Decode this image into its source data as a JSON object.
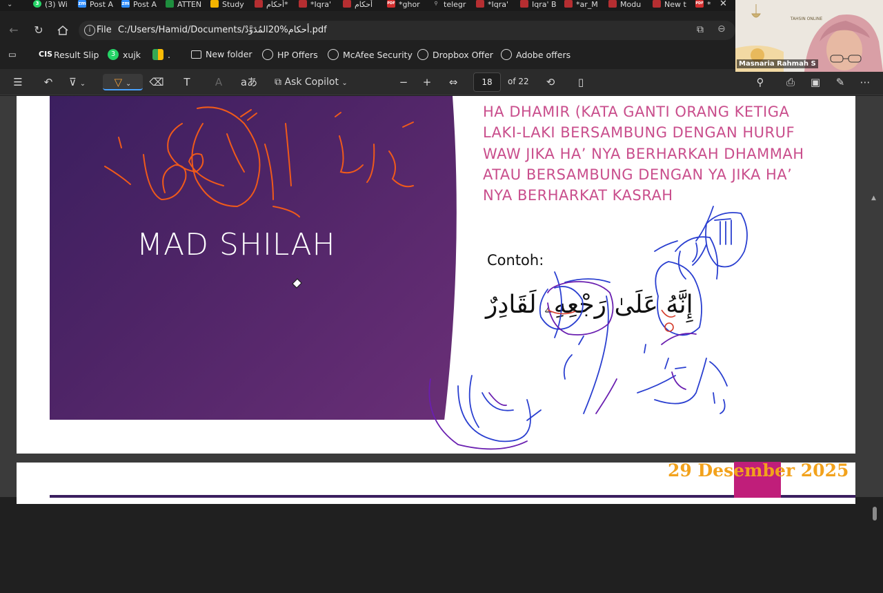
{
  "tabs": [
    {
      "label": "(3) Wi",
      "icon": "whatsapp-icon",
      "color": "#25d366",
      "badge": "3"
    },
    {
      "label": "Post A",
      "icon": "zoom-icon",
      "color": "#2d8cff",
      "badge": "zm"
    },
    {
      "label": "Post A",
      "icon": "zoom-icon",
      "color": "#2d8cff",
      "badge": "zm"
    },
    {
      "label": "ATTEN",
      "icon": "sheets-icon",
      "color": "#1e8e3e",
      "badge": ""
    },
    {
      "label": "Study",
      "icon": "drive-icon",
      "color": "#f4b400",
      "badge": ""
    },
    {
      "label": "أحكام*",
      "icon": "pdf-icon",
      "color": "#b52e31",
      "badge": ""
    },
    {
      "label": "*Iqra'",
      "icon": "pdf-icon",
      "color": "#b52e31",
      "badge": ""
    },
    {
      "label": "أحكام",
      "icon": "pdf-icon",
      "color": "#b52e31",
      "badge": ""
    },
    {
      "label": "*ghor",
      "icon": "pdf-icon",
      "color": "#d32f2f",
      "badge": "PDF"
    },
    {
      "label": "telegr",
      "icon": "search-icon",
      "color": "#555555",
      "badge": ""
    },
    {
      "label": "*Iqra'",
      "icon": "pdf-icon",
      "color": "#b52e31",
      "badge": ""
    },
    {
      "label": "Iqra' B",
      "icon": "pdf-icon",
      "color": "#b52e31",
      "badge": ""
    },
    {
      "label": "*ar_M",
      "icon": "pdf-icon",
      "color": "#b52e31",
      "badge": ""
    },
    {
      "label": "Modu",
      "icon": "pdf-icon",
      "color": "#b52e31",
      "badge": ""
    },
    {
      "label": "New t",
      "icon": "pdf-icon",
      "color": "#b52e31",
      "badge": ""
    },
    {
      "label": "*",
      "icon": "pdf-icon",
      "color": "#d32f2f",
      "badge": "PDF"
    }
  ],
  "address": {
    "scheme": "File",
    "url": "C:/Users/Hamid/Documents/أحكام%20المُدَوَّدْ.pdf"
  },
  "bookmarks": [
    {
      "label": "Result Slip",
      "icon": "cis-logo-icon"
    },
    {
      "label": "xujk",
      "icon": "whatsapp-icon"
    },
    {
      "label": ".",
      "icon": "meet-icon"
    },
    {
      "label": "New folder",
      "icon": "folder-icon"
    },
    {
      "label": "HP Offers",
      "icon": "globe-icon"
    },
    {
      "label": "McAfee Security",
      "icon": "globe-icon"
    },
    {
      "label": "Dropbox Offer",
      "icon": "globe-icon"
    },
    {
      "label": "Adobe offers",
      "icon": "globe-icon"
    }
  ],
  "toolbar": {
    "copilot_label": "Ask Copilot",
    "page_current": "18",
    "page_total": "of 22"
  },
  "slide": {
    "title": "MAD SHILAH",
    "description": "HA DHAMIR (KATA GANTI ORANG KETIGA LAKI-LAKI BERSAMBUNG DENGAN HURUF WAW JIKA HA’ NYA BERHARKAH DHAMMAH ATAU BERSAMBUNG DENGAN YA JIKA HA’ NYA BERHARKAT KASRAH",
    "example_label": "Contoh:",
    "example_arabic": "إِنَّهُ عَلَىٰ رَجْعِهِۦ لَقَادِرٌ"
  },
  "overlay": {
    "date": "29 Desember 2025"
  },
  "video": {
    "participant": "Masnaria Rahmah S",
    "banner_text": "TAHSIN ONLINE"
  },
  "colors": {
    "slide_purple": "#4d2466",
    "description_pink": "#c94e8c",
    "ink_orange": "#f05a1a",
    "ink_blue": "#2a3fd0",
    "date_gold": "#f2a21c",
    "date_badge": "#c01e7a"
  }
}
